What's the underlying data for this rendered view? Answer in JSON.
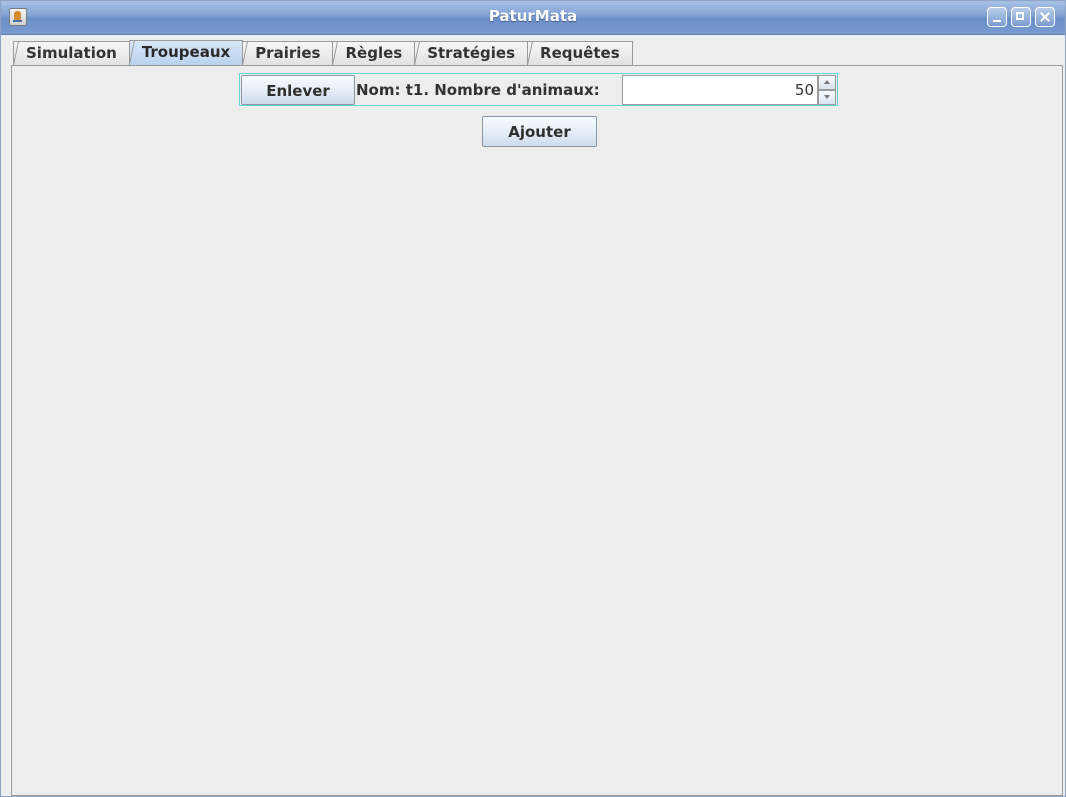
{
  "window": {
    "title": "PaturMata"
  },
  "tabs": [
    {
      "label": "Simulation",
      "active": false
    },
    {
      "label": "Troupeaux",
      "active": true
    },
    {
      "label": "Prairies",
      "active": false
    },
    {
      "label": "Règles",
      "active": false
    },
    {
      "label": "Stratégies",
      "active": false
    },
    {
      "label": "Requêtes",
      "active": false
    }
  ],
  "herd_row": {
    "remove_label": "Enlever",
    "name_label": "Nom: t1. Nombre d'animaux:",
    "animal_count": "50"
  },
  "add_label": "Ajouter",
  "colors": {
    "title_bar": "#7fa0d2",
    "active_tab": "#c7daf1",
    "row_focus_border": "#5fd6d8",
    "panel_background": "#ededed"
  },
  "icons": {
    "app": "java-app-icon",
    "minimize": "minimize-icon",
    "maximize": "maximize-icon",
    "close": "close-icon"
  }
}
